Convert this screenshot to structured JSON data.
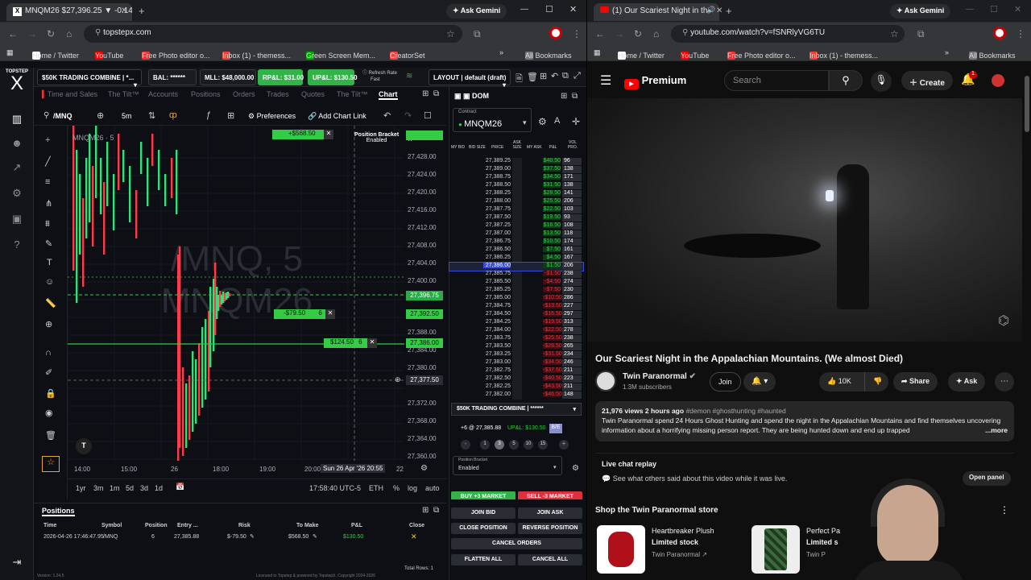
{
  "left_browser": {
    "tab_title": "MNQM26 $27,396.25 ▼ -0.14%",
    "ask_gemini": "Ask Gemini",
    "url": "topstepx.com",
    "bookmarks": [
      "Home / Twitter",
      "YouTube",
      "Free Photo editor o...",
      "Inbox (1) - themess...",
      "Green Screen Mem...",
      "CreatorSet"
    ],
    "all_bookmarks": "All Bookmarks"
  },
  "right_browser": {
    "tab_title": "(1) Our Scariest Night in th",
    "ask_gemini": "Ask Gemini",
    "url": "youtube.com/watch?v=fSNRlyVG6TU",
    "bookmarks": [
      "Home / Twitter",
      "YouTube",
      "Free Photo editor o...",
      "Inbox (1) - themess..."
    ],
    "all_bookmarks": "All Bookmarks"
  },
  "topstep": {
    "logo": "TOPSTEP",
    "account": "$50K TRADING COMBINE | *...",
    "bal": "BAL: ******",
    "mll": "MLL: $48,000.00",
    "rpnl": "RP&L: $31.00",
    "upnl": "UP&L: $130.50",
    "refresh": "Refresh Rate",
    "refresh_val": "Fast",
    "layout": "LAYOUT | default (draft)",
    "chart_tabs": [
      "Time and Sales",
      "The Tilt™",
      "Accounts",
      "Positions",
      "Orders",
      "Trades",
      "Quotes",
      "The Tilt™",
      "Chart"
    ],
    "symbol": "/MNQ",
    "interval": "5m",
    "preferences": "Preferences",
    "add_chart_link": "Add Chart Link",
    "legend": "MNQM26 · 5",
    "watermark_1": "/MNQ, 5",
    "watermark_2": "MNQM26",
    "position_bracket": "Position Bracket",
    "position_bracket_status": "Enabled",
    "order_labels": {
      "top": "+$568.50",
      "mid": "-$79.50",
      "low": "$124.50",
      "qty": "6"
    },
    "y_ticks": [
      "27,428.00",
      "27,424.00",
      "27,420.00",
      "27,416.00",
      "27,412.00",
      "27,408.00",
      "27,404.00",
      "27,400.00",
      "27,396.00",
      "27,392.00",
      "27,388.00",
      "27,384.00",
      "27,380.00",
      "27,377.50",
      "27,372.00",
      "27,368.00",
      "27,364.00",
      "27,360.00"
    ],
    "price_flags": {
      "current": "27,396.75",
      "stop": "27,392.50",
      "entry": "27,386.00",
      "cursor": "27,377.50"
    },
    "x_ticks": [
      "14:00",
      "15:00",
      "26",
      "18:00",
      "19:00",
      "20:00",
      "22"
    ],
    "x_cursor": "Sun 26 Apr '26   20:55",
    "ranges": [
      "1yr",
      "3m",
      "1m",
      "5d",
      "3d",
      "1d"
    ],
    "clock": "17:58:40 UTC-5",
    "eth": "ETH",
    "pct": "%",
    "log": "log",
    "auto": "auto",
    "dom_title": "DOM",
    "contract_label": "Contract",
    "contract": "MNQM26",
    "dom_headers": [
      "MY BID",
      "BID SIZE",
      "PRICE",
      "ASK SIZE",
      "MY ASK",
      "P&L",
      "VOL PRO."
    ],
    "dom_rows": [
      [
        "27,389.25",
        "$40.50",
        "96"
      ],
      [
        "27,389.00",
        "$37.50",
        "138"
      ],
      [
        "27,388.75",
        "$34.50",
        "171"
      ],
      [
        "27,388.50",
        "$31.50",
        "138"
      ],
      [
        "27,388.25",
        "$28.50",
        "141"
      ],
      [
        "27,388.00",
        "$25.50",
        "206"
      ],
      [
        "27,387.75",
        "$22.50",
        "103"
      ],
      [
        "27,387.50",
        "$19.50",
        "93"
      ],
      [
        "27,387.25",
        "$16.50",
        "108"
      ],
      [
        "27,387.00",
        "$13.50",
        "118"
      ],
      [
        "27,386.75",
        "$10.50",
        "174"
      ],
      [
        "27,386.50",
        "$7.50",
        "161"
      ],
      [
        "27,386.25",
        "$4.50",
        "167"
      ],
      [
        "27,386.00",
        "$1.50",
        "206"
      ],
      [
        "27,385.75",
        "-$1.50",
        "238"
      ],
      [
        "27,385.50",
        "-$4.50",
        "274"
      ],
      [
        "27,385.25",
        "-$7.50",
        "230"
      ],
      [
        "27,385.00",
        "-$10.50",
        "286"
      ],
      [
        "27,384.75",
        "-$13.50",
        "227"
      ],
      [
        "27,384.50",
        "-$16.50",
        "297"
      ],
      [
        "27,384.25",
        "-$19.50",
        "313"
      ],
      [
        "27,384.00",
        "-$22.50",
        "278"
      ],
      [
        "27,383.75",
        "-$25.50",
        "238"
      ],
      [
        "27,383.50",
        "-$28.50",
        "265"
      ],
      [
        "27,383.25",
        "-$31.50",
        "234"
      ],
      [
        "27,383.00",
        "-$34.50",
        "246"
      ],
      [
        "27,382.75",
        "-$37.50",
        "211"
      ],
      [
        "27,382.50",
        "-$40.50",
        "223"
      ],
      [
        "27,382.25",
        "-$43.50",
        "211"
      ],
      [
        "27,382.00",
        "-$46.50",
        "148"
      ]
    ],
    "dom_account": "$50K TRADING COMBINE | ******",
    "dom_position": "+6 @ 27,385.88",
    "dom_upnl": "UP&L: $130.50",
    "be": "B/E",
    "qty_buttons": [
      "1",
      "3",
      "5",
      "10",
      "15"
    ],
    "bracket_label": "Position Bracket",
    "bracket_value": "Enabled",
    "buy_market": "BUY +3 MARKET",
    "sell_market": "SELL -3 MARKET",
    "join_bid": "JOIN BID",
    "join_ask": "JOIN ASK",
    "close_position": "CLOSE POSITION",
    "reverse_position": "REVERSE POSITION",
    "cancel_orders": "CANCEL ORDERS",
    "flatten_all": "FLATTEN ALL",
    "cancel_all": "CANCEL ALL",
    "positions_title": "Positions",
    "pos_headers": [
      "Time",
      "Symbol",
      "Position",
      "Entry ...",
      "Risk",
      "To Make",
      "P&L",
      "Close"
    ],
    "pos_row": [
      "2026-04-26 17:46:47.95",
      "/MNQ",
      "6",
      "27,385.88",
      "$-79.50",
      "$568.50",
      "$130.50"
    ],
    "total_rows": "Total Rows: 1",
    "version": "Version: 1.24.5",
    "license": "Licensed to Topstep & powered by TopstepX. Copyright 2024-2026"
  },
  "youtube": {
    "premium": "Premium",
    "search_placeholder": "Search",
    "create": "Create",
    "notif_count": "1",
    "title": "Our Scariest Night in the Appalachian Mountains. (We almost Died)",
    "channel": "Twin Paranormal",
    "subs": "1.3M subscribers",
    "join": "Join",
    "likes": "10K",
    "share": "Share",
    "ask": "Ask",
    "views": "21,976 views",
    "time": "2 hours ago",
    "tags": "#demon #ghosthunting #haunted",
    "description": "Twin Paranormal spend 24 Hours Ghost Hunting and spend the night in the Appalachian Mountains and find themselves uncovering information about a horrifying missing person report. They are being hunted down and end up trapped",
    "more": "...more",
    "chat_replay": "Live chat replay",
    "chat_desc": "See what others said about this video while it was live.",
    "open_panel": "Open panel",
    "store_title": "Shop the Twin Paranormal store",
    "product1_name": "Heartbreaker Plush",
    "product1_stock": "Limited stock",
    "product1_seller": "Twin Paranormal",
    "product2_name": "Perfect Pa",
    "product2_stock": "Limited s",
    "product2_seller": "Twin P"
  }
}
